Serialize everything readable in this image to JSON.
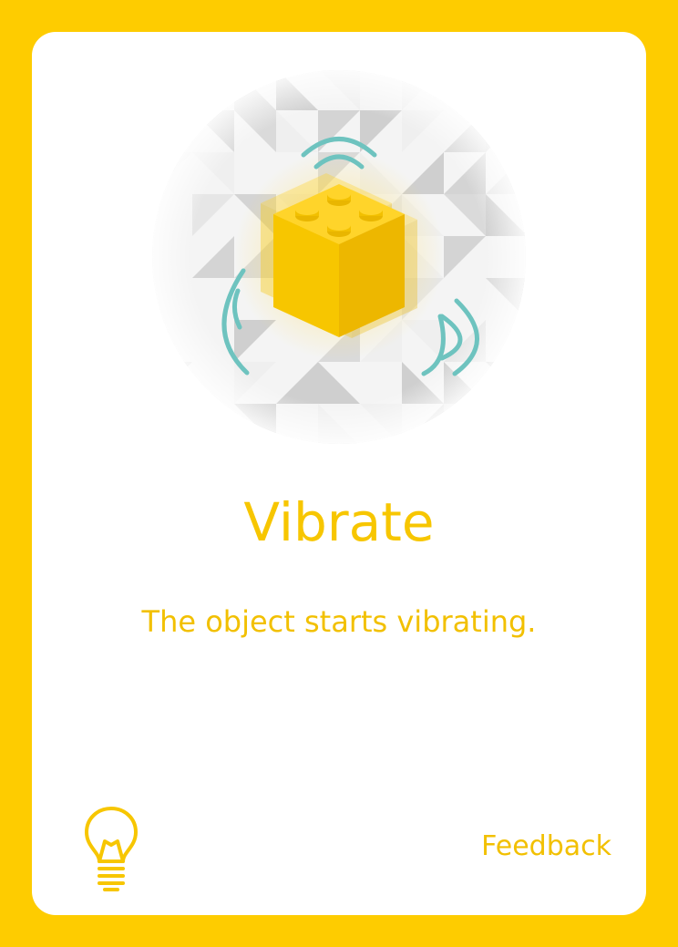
{
  "card": {
    "title": "Vibrate",
    "description": "The object starts vibrating.",
    "feedback_label": "Feedback"
  },
  "icons": {
    "illustration": "vibrating-brick-icon",
    "hint": "lightbulb-icon"
  },
  "colors": {
    "background": "#FECC00",
    "card": "#FFFFFF",
    "text": "#F2C000",
    "vibration_lines": "#6EC3BF",
    "brick_top": "#FFD42A",
    "brick_left": "#F7C600",
    "brick_right": "#E9B600"
  }
}
